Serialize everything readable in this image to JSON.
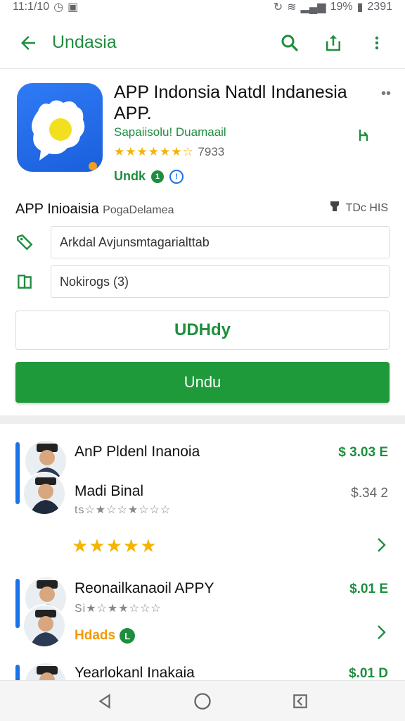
{
  "status_bar": {
    "time": "11:1/10",
    "battery_text": "19%",
    "right_text": "2391"
  },
  "app_bar": {
    "title": "Undasia",
    "icons": [
      "back-arrow-icon",
      "search-icon",
      "share-icon",
      "more-vert-icon"
    ]
  },
  "app": {
    "name": "APP Indonsia Natdl Indanesia APP.",
    "developer": "Sapaiisolu! Duamaail",
    "stars": "★★★★★★☆",
    "rating_text": "7933",
    "badge_label": "Undk",
    "badge_dot": "1",
    "badge_info": "!"
  },
  "details": {
    "section_title": "APP Inioaisia",
    "section_subtitle": "PogaDelamea",
    "meta": "TDc HIS",
    "field_1_value": "Arkdal Avjunsmtagarialttab",
    "field_2_value": "Nokirogs (3)"
  },
  "buttons": {
    "outline_label": "UDHdy",
    "primary_label": "Undu"
  },
  "list": [
    {
      "title_1": "AnP Pldenl Inanoia",
      "price_1": "$ 3.03 E",
      "title_2": "Madi Binal",
      "price_2": "$.34 2",
      "stars_small": "ts☆★☆☆★☆☆☆",
      "stars_big": "★★★★★"
    },
    {
      "title": "Reonailkanaoil APPY",
      "price": "$.01 E",
      "stars_small": "Si★☆★★☆☆☆",
      "tag": "Hdads",
      "tag_dot": "L"
    },
    {
      "title": "Yearlokanl Inakaia",
      "price": "$.01 D"
    }
  ],
  "colors": {
    "accent_green": "#1e8e3e",
    "primary_button": "#1f9a3a",
    "star_yellow": "#f4b400",
    "link_blue": "#1a73e8"
  }
}
